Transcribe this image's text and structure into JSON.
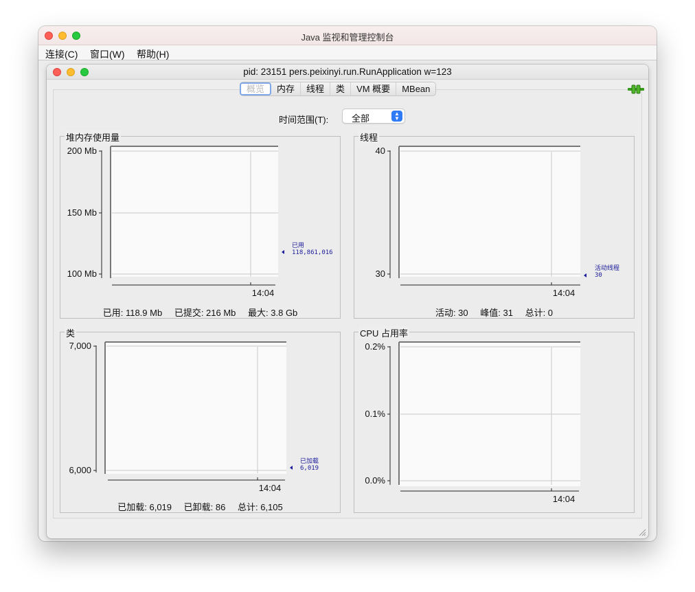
{
  "outer_window": {
    "title": "Java 监视和管理控制台",
    "menu": [
      "连接(C)",
      "窗口(W)",
      "帮助(H)"
    ]
  },
  "inner_window": {
    "title": "pid: 23151 pers.peixinyi.run.RunApplication w=123",
    "tabs": [
      "概览",
      "内存",
      "线程",
      "类",
      "VM 概要",
      "MBean"
    ],
    "active_tab": "概览"
  },
  "time_range": {
    "label": "时间范围(T):",
    "value": "全部"
  },
  "colors": {
    "series": "#1a1a9c",
    "accent": "#2f7bf5",
    "connect_icon": "#3a9a1e"
  },
  "panels": {
    "heap": {
      "title": "堆内存使用量",
      "footer": [
        "已用: 118.9 Mb",
        "已提交: 216 Mb",
        "最大: 3.8 Gb"
      ]
    },
    "threads": {
      "title": "线程",
      "footer": [
        "活动: 30",
        "峰值: 31",
        "总计: 0"
      ]
    },
    "classes": {
      "title": "类",
      "footer": [
        "已加载: 6,019",
        "已卸载: 86",
        "总计: 6,105"
      ]
    },
    "cpu": {
      "title": "CPU 占用率",
      "footer": []
    }
  },
  "chart_data": [
    {
      "type": "line",
      "title": "堆内存使用量",
      "y_ticks": [
        "200 Mb",
        "150 Mb",
        "100 Mb"
      ],
      "ylim": [
        100,
        200
      ],
      "y_unit": "Mb",
      "x_ticks": [
        "14:04"
      ],
      "series": [
        {
          "name": "已用",
          "value_label": "118,861,016",
          "last_value": 118861016
        }
      ]
    },
    {
      "type": "line",
      "title": "线程",
      "y_ticks": [
        "40",
        "30"
      ],
      "ylim": [
        30,
        40
      ],
      "x_ticks": [
        "14:04"
      ],
      "series": [
        {
          "name": "活动线程",
          "value_label": "30",
          "last_value": 30
        }
      ]
    },
    {
      "type": "line",
      "title": "类",
      "y_ticks": [
        "7,000",
        "6,000"
      ],
      "ylim": [
        6000,
        7000
      ],
      "x_ticks": [
        "14:04"
      ],
      "series": [
        {
          "name": "已加载",
          "value_label": "6,019",
          "last_value": 6019
        }
      ]
    },
    {
      "type": "line",
      "title": "CPU 占用率",
      "y_ticks": [
        "0.2%",
        "0.1%",
        "0.0%"
      ],
      "ylim": [
        0,
        0.2
      ],
      "y_unit": "%",
      "x_ticks": [
        "14:04"
      ],
      "series": []
    }
  ]
}
